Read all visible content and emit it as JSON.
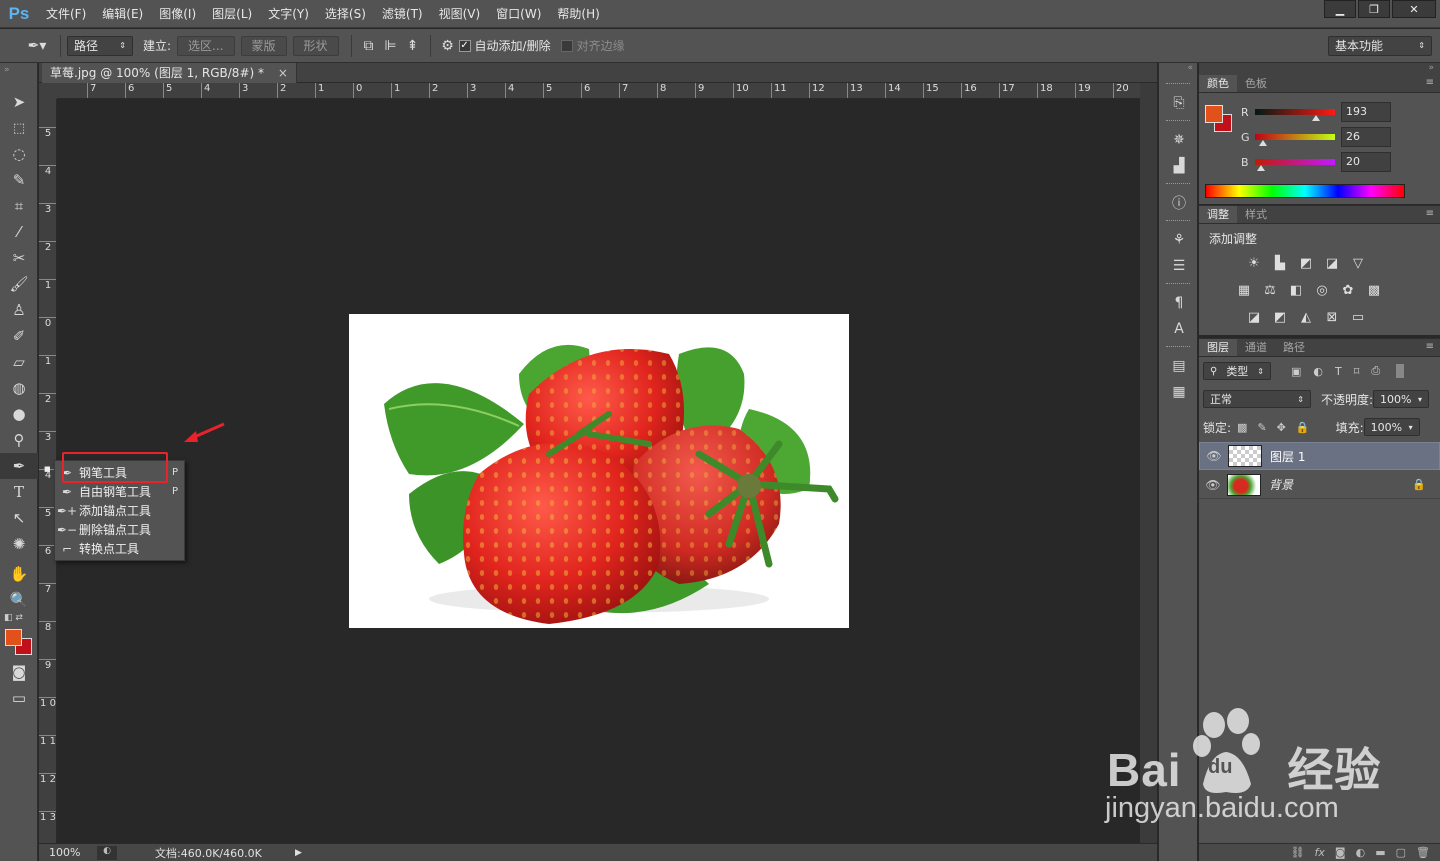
{
  "app": {
    "logo": "Ps"
  },
  "menu": [
    "文件(F)",
    "编辑(E)",
    "图像(I)",
    "图层(L)",
    "文字(Y)",
    "选择(S)",
    "滤镜(T)",
    "视图(V)",
    "窗口(W)",
    "帮助(H)"
  ],
  "window_controls": {
    "minimize": "▁",
    "restore": "❐",
    "close": "✕"
  },
  "options": {
    "mode_select": "路径",
    "make_label": "建立:",
    "selection_btn": "选区...",
    "mask_btn": "蒙版",
    "shape_btn": "形状",
    "auto_add_delete_label": "自动添加/删除",
    "auto_add_delete_checked": true,
    "align_edges_label": "对齐边缘",
    "workspace": "基本功能"
  },
  "document": {
    "tab_title": "草莓.jpg @ 100% (图层 1, RGB/8#) *",
    "close": "×",
    "ruler_h": [
      "7",
      "6",
      "5",
      "4",
      "3",
      "2",
      "1",
      "0",
      "1",
      "2",
      "3",
      "4",
      "5",
      "6",
      "7",
      "8",
      "9",
      "10",
      "11",
      "12",
      "13",
      "14",
      "15",
      "16",
      "17",
      "18",
      "19",
      "20"
    ],
    "ruler_v": [
      "5",
      "4",
      "3",
      "2",
      "1",
      "0",
      "1",
      "2",
      "3",
      "4",
      "5",
      "6",
      "7",
      "8",
      "9",
      "1 0",
      "1 1",
      "1 2",
      "1 3"
    ]
  },
  "status": {
    "zoom": "100%",
    "doc_size": "文档:460.0K/460.0K",
    "arrow": "▶"
  },
  "flyout": {
    "items": [
      {
        "label": "钢笔工具",
        "shortcut": "P",
        "selected": true
      },
      {
        "label": "自由钢笔工具",
        "shortcut": "P",
        "selected": false
      },
      {
        "label": "添加锚点工具",
        "shortcut": "",
        "selected": false
      },
      {
        "label": "删除锚点工具",
        "shortcut": "",
        "selected": false
      },
      {
        "label": "转换点工具",
        "shortcut": "",
        "selected": false
      }
    ],
    "bullet": "■"
  },
  "color_panel": {
    "tabs": [
      "颜色",
      "色板"
    ],
    "r_label": "R",
    "g_label": "G",
    "b_label": "B",
    "r": "193",
    "g": "26",
    "b": "20",
    "r_level": 0.757,
    "g_level": 0.102,
    "b_level": 0.078,
    "foreground": "#e0521a",
    "background": "#c1101a"
  },
  "adjust_panel": {
    "tabs": [
      "调整",
      "样式"
    ],
    "title": "添加调整"
  },
  "layers_panel": {
    "tabs": [
      "图层",
      "通道",
      "路径"
    ],
    "filter_kind": "类型",
    "blend_mode": "正常",
    "opacity_label": "不透明度:",
    "opacity": "100%",
    "lock_label": "锁定:",
    "fill_label": "填充:",
    "fill": "100%",
    "layers": [
      {
        "name": "图层 1",
        "selected": true
      },
      {
        "name": "背景",
        "selected": false
      }
    ]
  },
  "watermark": {
    "brand": "Bai 经验",
    "url": "jingyan.baidu.com",
    "du": "du"
  }
}
